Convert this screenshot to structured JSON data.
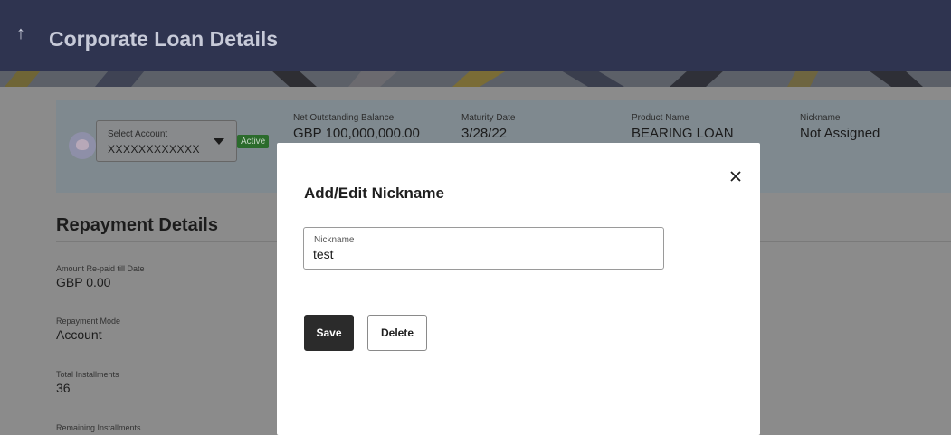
{
  "header": {
    "title": "Corporate Loan Details",
    "back_icon": "up-arrow-icon",
    "color": "#2f3450"
  },
  "account": {
    "select_label": "Select Account",
    "select_value": "XXXXXXXXXXXX",
    "status": "Active",
    "summary": [
      {
        "label": "Net Outstanding Balance",
        "value": "GBP 100,000,000.00"
      },
      {
        "label": "Maturity Date",
        "value": "3/28/22"
      },
      {
        "label": "Product Name",
        "value": "BEARING LOAN"
      },
      {
        "label": "Nickname",
        "value": "Not Assigned"
      }
    ]
  },
  "repayment": {
    "title": "Repayment Details",
    "items": [
      {
        "label": "Amount Re-paid till Date",
        "value": "GBP 0.00"
      },
      {
        "label": "Repayment Mode",
        "value": "Account"
      },
      {
        "label": "Total Installments",
        "value": "36"
      },
      {
        "label": "Remaining Installments",
        "value": ""
      }
    ]
  },
  "modal": {
    "title": "Add/Edit Nickname",
    "field_label": "Nickname",
    "field_value": "test",
    "save_label": "Save",
    "delete_label": "Delete",
    "close_icon": "close-icon"
  }
}
